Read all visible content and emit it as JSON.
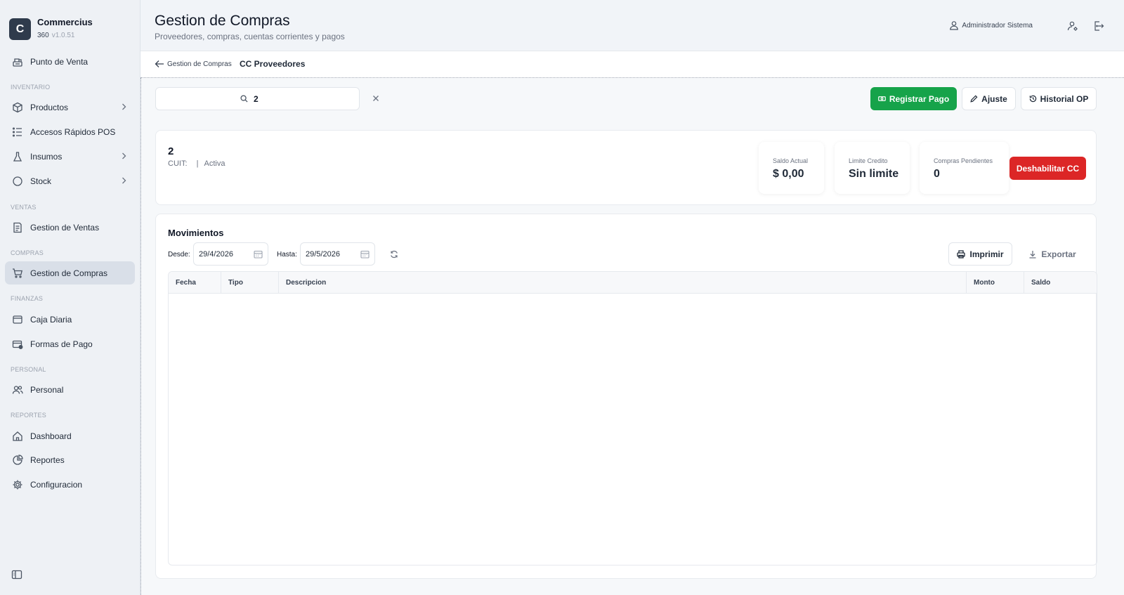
{
  "brand": {
    "logo_letter": "C",
    "name": "Commercius",
    "sub": "360",
    "version": "v1.0.51"
  },
  "sidebar": {
    "items": [
      {
        "label": "Punto de Venta",
        "icon": "cash-register-icon"
      },
      {
        "section": "INVENTARIO"
      },
      {
        "label": "Productos",
        "icon": "box-icon",
        "has_children": true
      },
      {
        "label": "Accesos Rápidos POS",
        "icon": "list-icon"
      },
      {
        "label": "Insumos",
        "icon": "flask-icon",
        "has_children": true
      },
      {
        "label": "Stock",
        "icon": "circle-icon",
        "has_children": true
      },
      {
        "section": "VENTAS"
      },
      {
        "label": "Gestion de Ventas",
        "icon": "receipt-icon"
      },
      {
        "section": "COMPRAS"
      },
      {
        "label": "Gestion de Compras",
        "icon": "cart-icon",
        "active": true
      },
      {
        "section": "FINANZAS"
      },
      {
        "label": "Caja Diaria",
        "icon": "wallet-icon"
      },
      {
        "label": "Formas de Pago",
        "icon": "card-icon"
      },
      {
        "section": "PERSONAL"
      },
      {
        "label": "Personal",
        "icon": "users-icon"
      },
      {
        "section": "REPORTES"
      },
      {
        "label": "Dashboard",
        "icon": "home-icon"
      },
      {
        "label": "Reportes",
        "icon": "chart-icon"
      },
      {
        "label": "Configuracion",
        "icon": "gear-icon"
      }
    ]
  },
  "header": {
    "title": "Gestion de Compras",
    "subtitle": "Proveedores, compras, cuentas corrientes y pagos",
    "user_name": "Administrador Sistema"
  },
  "breadcrumb": {
    "back_label": "Gestion de Compras",
    "current": "CC Proveedores"
  },
  "search": {
    "value": "2"
  },
  "toolbar": {
    "register_payment": "Registrar Pago",
    "adjust": "Ajuste",
    "history": "Historial OP"
  },
  "provider": {
    "name": "2",
    "cuit_label": "CUIT:",
    "status": "Activa",
    "stats": [
      {
        "label": "Saldo Actual",
        "value": "$ 0,00"
      },
      {
        "label": "Limite Credito",
        "value": "Sin limite"
      },
      {
        "label": "Compras Pendientes",
        "value": "0"
      }
    ],
    "disable_button": "Deshabilitar CC"
  },
  "movements": {
    "title": "Movimientos",
    "from_label": "Desde:",
    "from_value": "29/4/2026",
    "to_label": "Hasta:",
    "to_value": "29/5/2026",
    "print_label": "Imprimir",
    "export_label": "Exportar",
    "columns": [
      "Fecha",
      "Tipo",
      "Descripcion",
      "Monto",
      "Saldo"
    ],
    "rows": []
  },
  "colors": {
    "primary_green": "#16a34a",
    "danger_red": "#dc2626",
    "logo_bg": "#2f3b4c",
    "active_nav_bg": "#d9dfe8"
  }
}
